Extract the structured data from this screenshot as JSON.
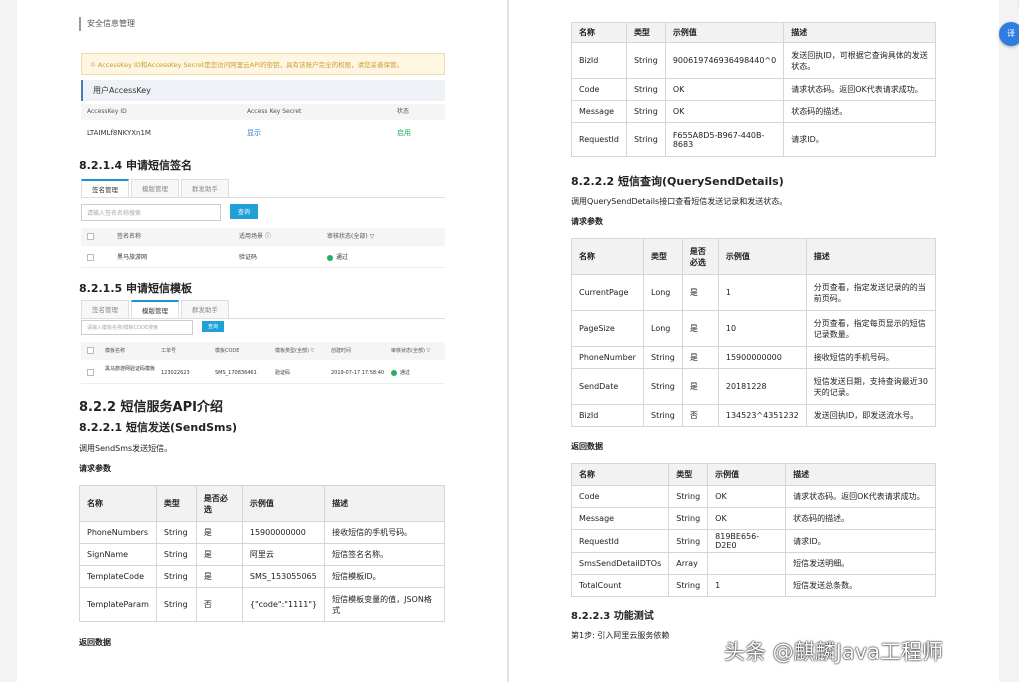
{
  "console": {
    "section_title": "安全信息管理",
    "warning": "① AccessKey ID和AccessKey Secret是您访问阿里云API的密钥，具有该账户完全的权限，请您妥善保管。",
    "card_title": "用户AccessKey",
    "columns": [
      "AccessKey ID",
      "Access Key Secret",
      "状态"
    ],
    "row": {
      "id": "LTAIMLf8NKYXn1M",
      "secret": "显示",
      "status": "启用"
    }
  },
  "left": {
    "h_sign": "8.2.1.4 申请短信签名",
    "sign_tabs": [
      "签名管理",
      "模版管理",
      "群发助手"
    ],
    "sign_search_placeholder": "请输入签名名称搜索",
    "sign_search_btn": "查询",
    "sign_cols": [
      "签名名称",
      "适用场景 ⓘ",
      "审核状态(全部) ▽"
    ],
    "sign_row": [
      "黑马旅游网",
      "验证码",
      "通过"
    ],
    "h_template": "8.2.1.5 申请短信模板",
    "tpl_tabs": [
      "签名管理",
      "模版管理",
      "群发助手"
    ],
    "tpl_search_placeholder": "请输入模板名称/模板CODE搜索",
    "tpl_search_btn": "查询",
    "tpl_cols": [
      "模板名称",
      "工单号",
      "模板CODE",
      "模板类型(全部) ▽",
      "创建时间",
      "审核状态(全部) ▽"
    ],
    "tpl_row": [
      "黑马旅游网验证码模板",
      "123022623",
      "SMS_170836461",
      "验证码",
      "2019-07-17 17:58:40",
      "通过"
    ],
    "h_api": "8.2.2 短信服务API介绍",
    "h_sendsms": "8.2.2.1 短信发送(SendSms)",
    "sendsms_desc": "调用SendSms发送短信。",
    "req_params_label": "请求参数",
    "req_table": {
      "headers": [
        "名称",
        "类型",
        "是否必选",
        "示例值",
        "描述"
      ],
      "rows": [
        [
          "PhoneNumbers",
          "String",
          "是",
          "15900000000",
          "接收短信的手机号码。"
        ],
        [
          "SignName",
          "String",
          "是",
          "阿里云",
          "短信签名名称。"
        ],
        [
          "TemplateCode",
          "String",
          "是",
          "SMS_153055065",
          "短信模板ID。"
        ],
        [
          "TemplateParam",
          "String",
          "否",
          "{\"code\":\"1111\"}",
          "短信模板变量的值，JSON格式"
        ]
      ]
    },
    "return_label": "返回数据"
  },
  "right": {
    "top_table": {
      "headers": [
        "名称",
        "类型",
        "示例值",
        "描述"
      ],
      "rows": [
        [
          "BizId",
          "String",
          "900619746936498440^0",
          "发送回执ID，可根据它查询具体的发送状态。"
        ],
        [
          "Code",
          "String",
          "OK",
          "请求状态码。返回OK代表请求成功。"
        ],
        [
          "Message",
          "String",
          "OK",
          "状态码的描述。"
        ],
        [
          "RequestId",
          "String",
          "F655A8D5-B967-440B-8683",
          "请求ID。"
        ]
      ]
    },
    "h_query": "8.2.2.2 短信查询(QuerySendDetails)",
    "query_desc": "调用QuerySendDetails接口查看短信发送记录和发送状态。",
    "req_params_label": "请求参数",
    "query_table": {
      "headers": [
        "名称",
        "类型",
        "是否必选",
        "示例值",
        "描述"
      ],
      "rows": [
        [
          "CurrentPage",
          "Long",
          "是",
          "1",
          "分页查看，指定发送记录的的当前页码。"
        ],
        [
          "PageSize",
          "Long",
          "是",
          "10",
          "分页查看，指定每页显示的短信记录数量。"
        ],
        [
          "PhoneNumber",
          "String",
          "是",
          "15900000000",
          "接收短信的手机号码。"
        ],
        [
          "SendDate",
          "String",
          "是",
          "20181228",
          "短信发送日期，支持查询最近30天的记录。"
        ],
        [
          "BizId",
          "String",
          "否",
          "134523^4351232",
          "发送回执ID，即发送流水号。"
        ]
      ]
    },
    "return_label": "返回数据",
    "return_table": {
      "headers": [
        "名称",
        "类型",
        "示例值",
        "描述"
      ],
      "rows": [
        [
          "Code",
          "String",
          "OK",
          "请求状态码。返回OK代表请求成功。"
        ],
        [
          "Message",
          "String",
          "OK",
          "状态码的描述。"
        ],
        [
          "RequestId",
          "String",
          "819BE656-D2E0",
          "请求ID。"
        ],
        [
          "SmsSendDetailDTOs",
          "Array",
          "",
          "短信发送明细。"
        ],
        [
          "TotalCount",
          "String",
          "1",
          "短信发送总条数。"
        ]
      ]
    },
    "h_test": "8.2.2.3 功能测试",
    "step1": "第1步: 引入阿里云服务依赖"
  },
  "overlay": {
    "side_button_label": "译",
    "watermark": "头条 @麒麟Java工程师"
  }
}
